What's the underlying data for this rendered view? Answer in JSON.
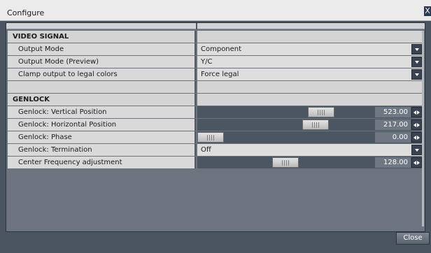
{
  "window": {
    "title": "Configure",
    "close_glyph": "X"
  },
  "video_signal": {
    "header": "VIDEO SIGNAL",
    "rows": [
      {
        "label": "Output Mode",
        "value": "Component"
      },
      {
        "label": "Output Mode (Preview)",
        "value": "Y/C"
      },
      {
        "label": "Clamp output to legal colors",
        "value": "Force legal"
      }
    ]
  },
  "genlock": {
    "header": "GENLOCK",
    "vertical": {
      "label": "Genlock: Vertical Position",
      "value": "523.00",
      "slider_fraction": 0.74
    },
    "horizontal": {
      "label": "Genlock: Horizontal Position",
      "value": "217.00",
      "slider_fraction": 0.7
    },
    "phase": {
      "label": "Genlock: Phase",
      "value": "0.00",
      "slider_fraction": 0.0
    },
    "termination": {
      "label": "Genlock: Termination",
      "value": "Off"
    },
    "center_freq": {
      "label": "Center Frequency adjustment",
      "value": "128.00",
      "slider_fraction": 0.5
    }
  },
  "footer": {
    "close_label": "Close"
  },
  "icons": {
    "dropdown": "chevron-down-icon",
    "spin": "left-right-arrows-icon",
    "close": "close-icon"
  },
  "colors": {
    "background": "#4b5461",
    "slider_track": "#4c5562",
    "cell": "#d9d9d9"
  }
}
